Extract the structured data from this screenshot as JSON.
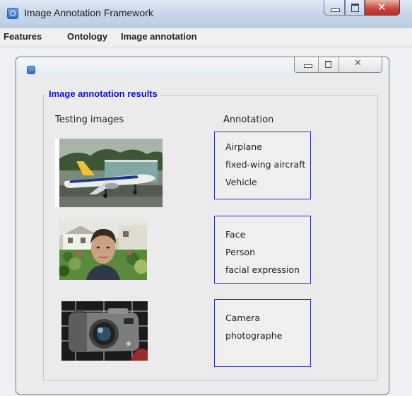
{
  "window": {
    "title": "Image Annotation Framework"
  },
  "menu": {
    "items": [
      "Features",
      "Ontology",
      "Image annotation"
    ]
  },
  "panel": {
    "group_title": "Image annotation results",
    "col_images": "Testing images",
    "col_annotation": "Annotation"
  },
  "results": [
    {
      "image": "airplane-image",
      "labels": [
        "Airplane",
        "fixed-wing aircraft",
        "Vehicle"
      ]
    },
    {
      "image": "face-image",
      "labels": [
        "Face",
        "Person",
        "facial expression"
      ]
    },
    {
      "image": "camera-image",
      "labels": [
        "Camera",
        "photographe"
      ]
    }
  ],
  "icons": {
    "app": "app-icon",
    "minimize": "minimize-icon",
    "maximize": "maximize-icon",
    "close": "close-icon"
  },
  "colors": {
    "group_title": "#1010e8",
    "annotation_border": "#2b2bd8"
  }
}
